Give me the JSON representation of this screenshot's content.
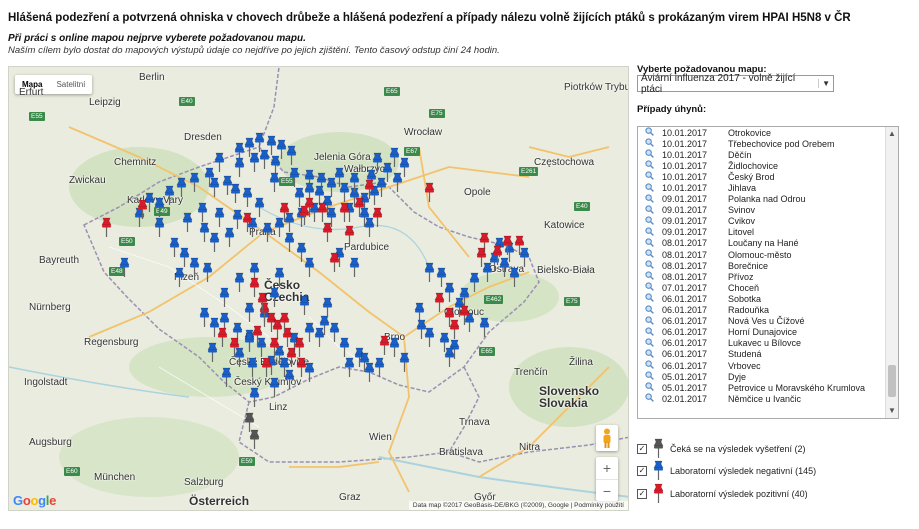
{
  "header": {
    "title": "Hlášená podezření a potvrzená ohniska v chovech drůbeže a hlášená podezření a případy nálezu volně žijících ptáků s prokázaným virem HPAI H5N8 v ČR",
    "instruction": "Při práci s online mapou nejprve vyberete požadovanou mapu.",
    "note": "Naším cílem bylo dostat do mapových výstupů údaje co nejdříve po jejich zjištění. Tento časový odstup činí 24 hodin."
  },
  "map": {
    "type_buttons": [
      "Mapa",
      "Satelitní"
    ],
    "active_type": "Mapa",
    "cities": [
      "Leipzig",
      "Dresden",
      "Chemnitz",
      "Zwickau",
      "Jelenia Góra",
      "Wałbrzych",
      "Wrocław",
      "Opole",
      "Częstochowa",
      "Katowice",
      "Bielsko-Biała",
      "Karlovy Vary",
      "Bayreuth",
      "Plzeň",
      "Pardubice",
      "Olomouc",
      "Brno",
      "České Budějovice",
      "Český Krumlov",
      "Regensburg",
      "Ingolstadt",
      "Linz",
      "Wien",
      "Bratislava",
      "Trnava",
      "Nitra",
      "Žilina",
      "Trenčín",
      "Augsburg",
      "München",
      "Salzburg",
      "Graz",
      "Győr",
      "Piotrków Trybunalski",
      "Erfurt",
      "Berlin",
      "Nürnberg",
      "Praha",
      "Ostrava"
    ],
    "country_labels": [
      "Česko\nCzechia",
      "Slovensko\nSlovakia",
      "Österreich"
    ],
    "highway_labels": [
      "E55",
      "E40",
      "E65",
      "E75",
      "E50",
      "E48",
      "E49",
      "E55",
      "E462",
      "E67",
      "E261",
      "E40",
      "E59",
      "E60",
      "E65",
      "E75"
    ],
    "google_logo": "Google",
    "attribution": "Data map ©2017 GeoBasis-DE/BKG (©2009), Google | Podmínky použití",
    "zoom_in": "+",
    "zoom_out": "−"
  },
  "panel": {
    "select_label": "Vyberte požadovanou mapu:",
    "selected_map": "Aviární influenza 2017 - volně žijící ptáci",
    "cases_label": "Případy úhynů:",
    "cases": [
      {
        "date": "10.01.2017",
        "place": "Otrokovice"
      },
      {
        "date": "10.01.2017",
        "place": "Třebechovice pod Orebem"
      },
      {
        "date": "10.01.2017",
        "place": "Děčín"
      },
      {
        "date": "10.01.2017",
        "place": "Židlochovice"
      },
      {
        "date": "10.01.2017",
        "place": "Český Brod"
      },
      {
        "date": "10.01.2017",
        "place": "Jihlava"
      },
      {
        "date": "09.01.2017",
        "place": "Polanka nad Odrou"
      },
      {
        "date": "09.01.2017",
        "place": "Svinov"
      },
      {
        "date": "09.01.2017",
        "place": "Cvikov"
      },
      {
        "date": "09.01.2017",
        "place": "Litovel"
      },
      {
        "date": "08.01.2017",
        "place": "Loučany na Hané"
      },
      {
        "date": "08.01.2017",
        "place": "Olomouc-město"
      },
      {
        "date": "08.01.2017",
        "place": "Borečnice"
      },
      {
        "date": "08.01.2017",
        "place": "Přívoz"
      },
      {
        "date": "07.01.2017",
        "place": "Choceň"
      },
      {
        "date": "06.01.2017",
        "place": "Sobotka"
      },
      {
        "date": "06.01.2017",
        "place": "Radouňka"
      },
      {
        "date": "06.01.2017",
        "place": "Nová Ves u Čížové"
      },
      {
        "date": "06.01.2017",
        "place": "Horní Dunajovice"
      },
      {
        "date": "06.01.2017",
        "place": "Lukavec u Bílovce"
      },
      {
        "date": "06.01.2017",
        "place": "Studená"
      },
      {
        "date": "06.01.2017",
        "place": "Vrbovec"
      },
      {
        "date": "05.01.2017",
        "place": "Dyje"
      },
      {
        "date": "05.01.2017",
        "place": "Petrovice u Moravského Krumlova"
      },
      {
        "date": "02.01.2017",
        "place": "Němčice u Ivančic"
      }
    ],
    "legend": [
      {
        "label": "Čeká se na výsledek vyšetření (2)",
        "color": "#555555",
        "checked": true
      },
      {
        "label": "Laboratorní výsledek negativní (145)",
        "color": "#1a5fc8",
        "checked": true
      },
      {
        "label": "Laboratorní výsledek pozitivní (40)",
        "color": "#d81b2a",
        "checked": true
      }
    ]
  },
  "colors": {
    "pin_negative": "#1a5fc8",
    "pin_positive": "#d81b2a",
    "pin_pending": "#555555",
    "land": "#e8ecdf",
    "border": "#9b8fb3"
  },
  "icons": {
    "case_row": "magnifier-icon",
    "map_marker": "push-pin-icon",
    "street_view": "pegman-icon"
  }
}
